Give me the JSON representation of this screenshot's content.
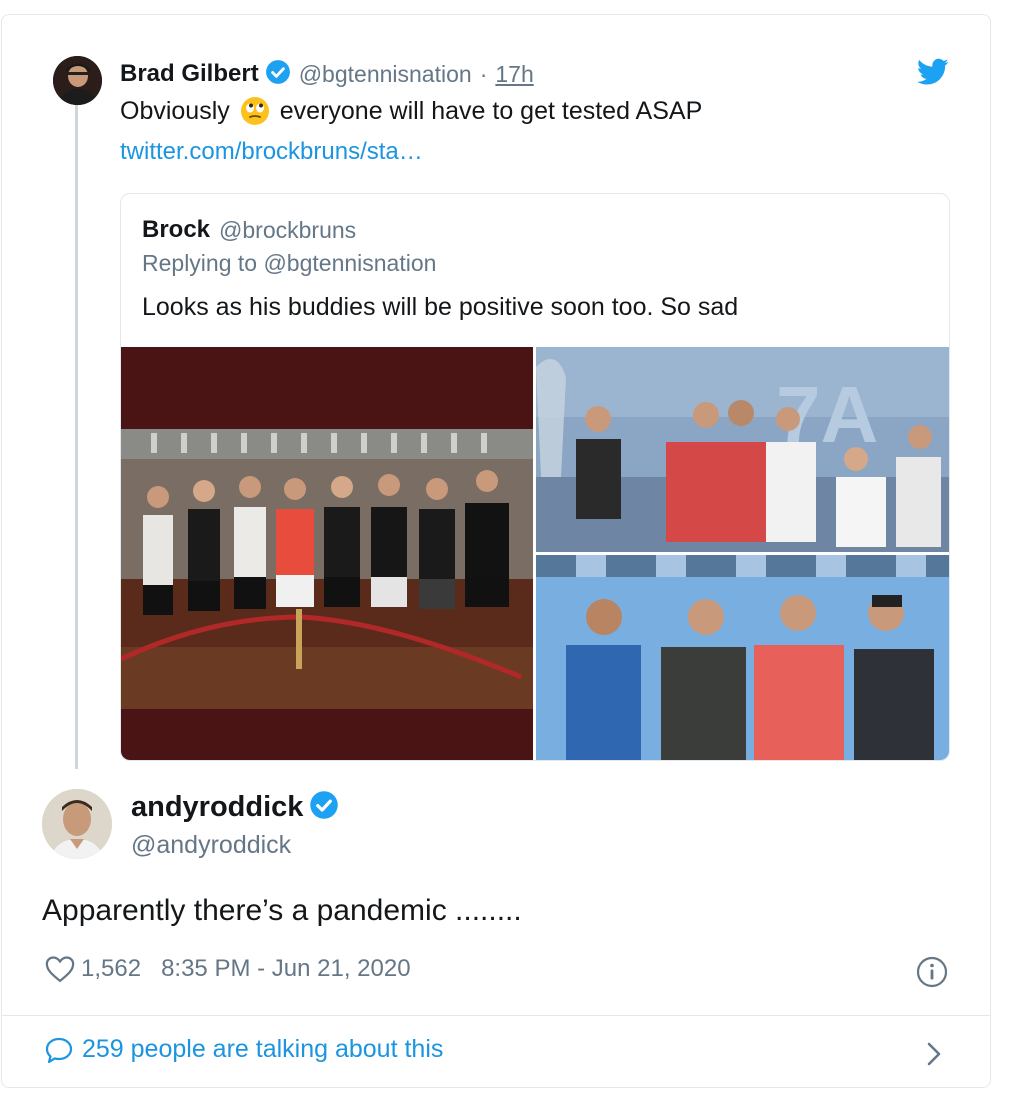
{
  "tweet": {
    "author_name": "Brad Gilbert",
    "author_handle": "@bgtennisnation",
    "separator": "·",
    "time": "17h",
    "text_before_emoji": "Obviously",
    "emoji": "rolling-eyes-emoji",
    "text_after_emoji": "everyone will have to get tested ASAP",
    "link": "twitter.com/brockbruns/sta…"
  },
  "quoted": {
    "author_name": "Brock",
    "author_handle": "@brockbruns",
    "replying_to": "Replying to @bgtennisnation",
    "text": "Looks as his buddies will be positive soon too. So sad",
    "photos": [
      "group-photo-men-in-room",
      "celebration-photo-court",
      "four-players-photo"
    ]
  },
  "reply": {
    "author_name": "andyroddick",
    "author_handle": "@andyroddick",
    "text": "Apparently there’s a pandemic ........",
    "likes": "1,562",
    "timestamp": "8:35 PM - Jun 21, 2020"
  },
  "footer": {
    "talking": "259 people are talking about this"
  },
  "icons": {
    "verified": "verified-badge-icon",
    "logo": "twitter-bird-icon",
    "heart": "heart-icon",
    "info": "info-icon",
    "comment": "comment-bubble-icon",
    "chevron": "chevron-right-icon"
  },
  "colors": {
    "link": "#1b95e0",
    "verified": "#1da1f2",
    "muted": "#657786",
    "border": "#e1e8ed"
  }
}
